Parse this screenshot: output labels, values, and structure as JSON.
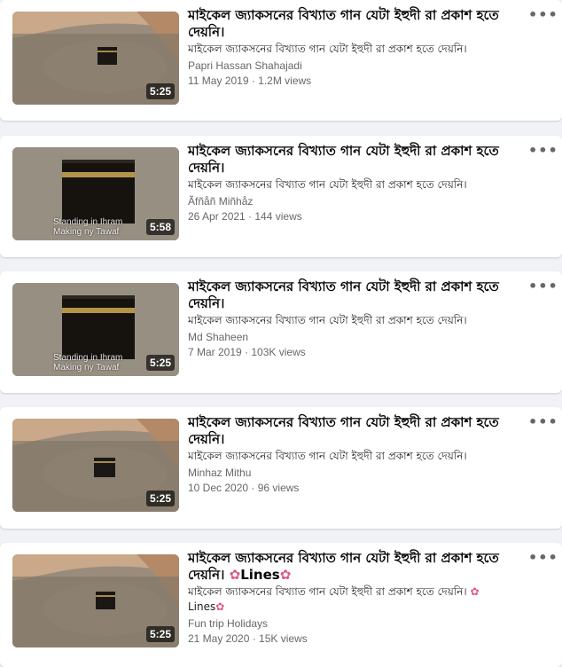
{
  "videos": [
    {
      "title": "মাইকেল জ্যাকসনের বিখ্যাত গান যেটা ইহুদী রা প্রকাশ হতে দেয়নি।",
      "description": "মাইকেল জ্যাকসনের বিখ্যাত গান যেটা ইহুদী রা প্রকাশ হতে দেয়নি।",
      "author": "Papri Hassan Shahajadi",
      "date_views": "11 May 2019 · 1.2M views",
      "duration": "5:25",
      "thumbnail": "kaaba-aerial"
    },
    {
      "title": "মাইকেল জ্যাকসনের বিখ্যাত গান যেটা ইহুদী রা প্রকাশ হতে দেয়নি।",
      "description": "মাইকেল জ্যাকসনের বিখ্যাত গান যেটা ইহুদী রা প্রকাশ হতে দেয়নি।",
      "author": "Ãfñåñ Miñhåz",
      "date_views": "26 Apr 2021 · 144 views",
      "duration": "5:58",
      "thumbnail": "kaaba-closeup",
      "overlay": "Standing in Ihram Making ny Tawaf"
    },
    {
      "title": "মাইকেল জ্যাকসনের বিখ্যাত গান যেটা ইহুদী রা প্রকাশ হতে দেয়নি।",
      "description": "মাইকেল জ্যাকসনের বিখ্যাত গান যেটা ইহুদী রা প্রকাশ হতে দেয়নি।",
      "author": "Md Shaheen",
      "date_views": "7 Mar 2019 · 103K views",
      "duration": "5:25",
      "thumbnail": "kaaba-closeup",
      "overlay": "Standing in Ihram Making ny Tawaf"
    },
    {
      "title": "মাইকেল জ্যাকসনের বিখ্যাত গান যেটা ইহুদী রা প্রকাশ হতে দেয়নি।",
      "description": "মাইকেল জ্যাকসনের বিখ্যাত গান যেটা ইহুদী রা প্রকাশ হতে দেয়নি।",
      "author": "Minhaz Mithu",
      "date_views": "10 Dec 2020 · 96 views",
      "duration": "5:25",
      "thumbnail": "kaaba-aerial"
    },
    {
      "title": "মাইকেল জ্যাকসনের বিখ্যাত গান যেটা ইহুদী রা প্রকাশ হতে দেয়নি।",
      "title_suffix": "Lines",
      "description": "মাইকেল জ্যাকসনের বিখ্যাত গান যেটা ইহুদী রা প্রকাশ হতে দেয়নি।",
      "description_suffix": "Lines",
      "author": "Fun trip Holidays",
      "date_views": "21 May 2020 · 15K views",
      "duration": "5:25",
      "thumbnail": "kaaba-aerial"
    }
  ],
  "more_icon": "more-horizontal-icon",
  "colors": {
    "background": "#f0f2f5",
    "card": "#ffffff",
    "title": "#050505",
    "meta": "#65676b"
  }
}
